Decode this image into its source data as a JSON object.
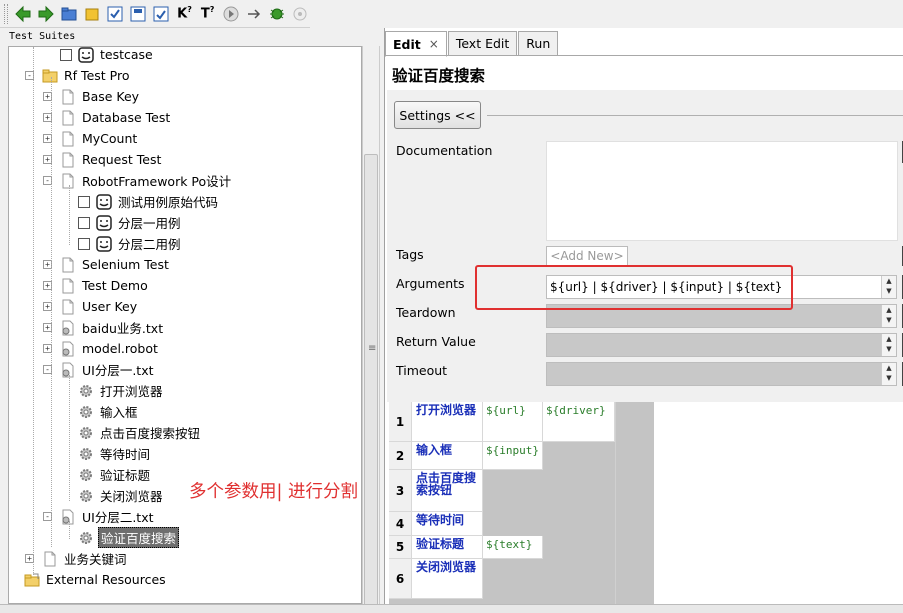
{
  "left_header": "Test Suites",
  "tree": [
    {
      "label": "testcase",
      "icon": "testcase-icon",
      "checkbox": true
    },
    {
      "label": "Rf Test Pro",
      "icon": "folder-icon",
      "expander": "-"
    },
    {
      "label": "Base Key",
      "icon": "file-icon",
      "expander": "+"
    },
    {
      "label": "Database Test",
      "icon": "file-icon",
      "expander": "+"
    },
    {
      "label": "MyCount",
      "icon": "file-icon",
      "expander": "+"
    },
    {
      "label": "Request Test",
      "icon": "file-icon",
      "expander": "+"
    },
    {
      "label": "RobotFramework Po设计",
      "icon": "file-icon",
      "expander": "-"
    },
    {
      "label": "测试用例原始代码",
      "icon": "testcase-icon",
      "checkbox": true
    },
    {
      "label": "分层一用例",
      "icon": "testcase-icon",
      "checkbox": true
    },
    {
      "label": "分层二用例",
      "icon": "testcase-icon",
      "checkbox": true
    },
    {
      "label": "Selenium Test",
      "icon": "file-icon",
      "expander": "+"
    },
    {
      "label": "Test Demo",
      "icon": "file-icon",
      "expander": "+"
    },
    {
      "label": "User Key",
      "icon": "file-icon",
      "expander": "+"
    },
    {
      "label": "baidu业务.txt",
      "icon": "resource-file-icon",
      "expander": "+"
    },
    {
      "label": "model.robot",
      "icon": "resource-file-icon",
      "expander": "+"
    },
    {
      "label": "UI分层一.txt",
      "icon": "resource-file-icon",
      "expander": "-"
    },
    {
      "label": "打开浏览器",
      "icon": "keyword-gear-icon"
    },
    {
      "label": "输入框",
      "icon": "keyword-gear-icon"
    },
    {
      "label": "点击百度搜索按钮",
      "icon": "keyword-gear-icon"
    },
    {
      "label": "等待时间",
      "icon": "keyword-gear-icon"
    },
    {
      "label": "验证标题",
      "icon": "keyword-gear-icon"
    },
    {
      "label": "关闭浏览器",
      "icon": "keyword-gear-icon"
    },
    {
      "label": "UI分层二.txt",
      "icon": "resource-file-icon",
      "expander": "-"
    },
    {
      "label": "验证百度搜索",
      "icon": "keyword-gear-icon",
      "selected": true
    },
    {
      "label": "业务关键词",
      "icon": "file-icon",
      "expander": "+"
    },
    {
      "label": "External Resources",
      "icon": "external-folder-icon"
    }
  ],
  "tabs": [
    {
      "label": "Edit",
      "active": true,
      "close": "×"
    },
    {
      "label": "Text Edit"
    },
    {
      "label": "Run"
    }
  ],
  "editor": {
    "title": "验证百度搜索",
    "settings_button": "Settings <<",
    "labels": {
      "documentation": "Documentation",
      "tags": "Tags",
      "arguments": "Arguments",
      "teardown": "Teardown",
      "return_value": "Return Value",
      "timeout": "Timeout"
    },
    "tags_placeholder": "<Add New>",
    "arguments_value": "${url} | ${driver} | ${input} | ${text}"
  },
  "grid": {
    "rows": [
      {
        "num": "1",
        "keyword": "打开浏览器",
        "args": [
          "${url}",
          "${driver}"
        ]
      },
      {
        "num": "2",
        "keyword": "输入框",
        "args": [
          "${input}"
        ]
      },
      {
        "num": "3",
        "keyword": "点击百度搜索按钮",
        "args": []
      },
      {
        "num": "4",
        "keyword": "等待时间",
        "args": []
      },
      {
        "num": "5",
        "keyword": "验证标题",
        "args": [
          "${text}"
        ]
      },
      {
        "num": "6",
        "keyword": "关闭浏览器",
        "args": []
      }
    ]
  },
  "annotation": "多个参数用| 进行分割",
  "colors": {
    "annotation": "#e03030",
    "keyword": "#1a2fb8",
    "argument": "#2a7d2a",
    "selected_bg": "#6e6e6e"
  }
}
